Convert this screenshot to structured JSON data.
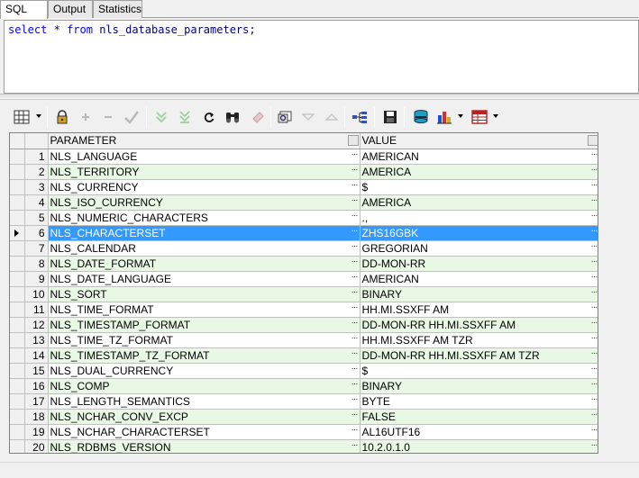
{
  "tabs": [
    {
      "label": "SQL",
      "active": true
    },
    {
      "label": "Output",
      "active": false
    },
    {
      "label": "Statistics",
      "active": false
    }
  ],
  "editor": {
    "kw_select": "select",
    "star": "*",
    "kw_from": "from",
    "rest": "nls_database_parameters;"
  },
  "toolbar": {
    "icons": [
      "grid-view-icon",
      "lock-icon",
      "add-record-icon",
      "delete-record-icon",
      "post-changes-icon",
      "fetch-next-page-icon",
      "fetch-last-page-icon",
      "refresh-icon",
      "find-icon",
      "clear-icon",
      "query-by-example-icon",
      "filter-icon",
      "sort-icon",
      "explain-plan-icon",
      "save-icon",
      "export-icon",
      "chart-icon",
      "table-icon"
    ]
  },
  "grid": {
    "columns": [
      "PARAMETER",
      "VALUE"
    ],
    "selected_row": 6,
    "rows": [
      {
        "n": "1",
        "p": "NLS_LANGUAGE",
        "v": "AMERICAN"
      },
      {
        "n": "2",
        "p": "NLS_TERRITORY",
        "v": "AMERICA"
      },
      {
        "n": "3",
        "p": "NLS_CURRENCY",
        "v": "$"
      },
      {
        "n": "4",
        "p": "NLS_ISO_CURRENCY",
        "v": "AMERICA"
      },
      {
        "n": "5",
        "p": "NLS_NUMERIC_CHARACTERS",
        "v": ".,"
      },
      {
        "n": "6",
        "p": "NLS_CHARACTERSET",
        "v": "ZHS16GBK"
      },
      {
        "n": "7",
        "p": "NLS_CALENDAR",
        "v": "GREGORIAN"
      },
      {
        "n": "8",
        "p": "NLS_DATE_FORMAT",
        "v": "DD-MON-RR"
      },
      {
        "n": "9",
        "p": "NLS_DATE_LANGUAGE",
        "v": "AMERICAN"
      },
      {
        "n": "10",
        "p": "NLS_SORT",
        "v": "BINARY"
      },
      {
        "n": "11",
        "p": "NLS_TIME_FORMAT",
        "v": "HH.MI.SSXFF AM"
      },
      {
        "n": "12",
        "p": "NLS_TIMESTAMP_FORMAT",
        "v": "DD-MON-RR HH.MI.SSXFF AM"
      },
      {
        "n": "13",
        "p": "NLS_TIME_TZ_FORMAT",
        "v": "HH.MI.SSXFF AM TZR"
      },
      {
        "n": "14",
        "p": "NLS_TIMESTAMP_TZ_FORMAT",
        "v": "DD-MON-RR HH.MI.SSXFF AM TZR"
      },
      {
        "n": "15",
        "p": "NLS_DUAL_CURRENCY",
        "v": "$"
      },
      {
        "n": "16",
        "p": "NLS_COMP",
        "v": "BINARY"
      },
      {
        "n": "17",
        "p": "NLS_LENGTH_SEMANTICS",
        "v": "BYTE"
      },
      {
        "n": "18",
        "p": "NLS_NCHAR_CONV_EXCP",
        "v": "FALSE"
      },
      {
        "n": "19",
        "p": "NLS_NCHAR_CHARACTERSET",
        "v": "AL16UTF16"
      },
      {
        "n": "20",
        "p": "NLS_RDBMS_VERSION",
        "v": "10.2.0.1.0"
      }
    ]
  }
}
